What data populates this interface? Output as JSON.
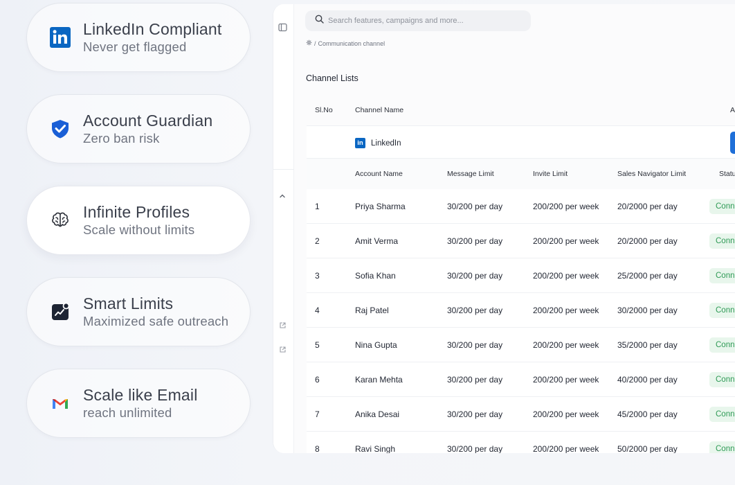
{
  "features": [
    {
      "title": "LinkedIn Compliant",
      "subtitle": "Never get flagged",
      "icon": "linkedin-icon"
    },
    {
      "title": "Account Guardian",
      "subtitle": "Zero ban risk",
      "icon": "shield-check-icon"
    },
    {
      "title": "Infinite Profiles",
      "subtitle": "Scale without limits",
      "icon": "brain-icon"
    },
    {
      "title": "Smart Limits",
      "subtitle": "Maximized safe outreach",
      "icon": "chart-trend-icon"
    },
    {
      "title": "Scale like Email",
      "subtitle": "reach unlimited",
      "icon": "gmail-icon"
    }
  ],
  "search": {
    "placeholder": "Search features, campaigns and more..."
  },
  "breadcrumb": {
    "separator": "/",
    "current": "Communication channel"
  },
  "page": {
    "title": "Channel Lists"
  },
  "table": {
    "headers": {
      "sl": "Sl.No",
      "channel": "Channel Name",
      "action": "A"
    },
    "channel": {
      "name": "LinkedIn",
      "logo_text": "in"
    },
    "columns": {
      "account": "Account Name",
      "message": "Message Limit",
      "invite": "Invite Limit",
      "sales": "Sales Navigator Limit",
      "status": "Statu"
    },
    "rows": [
      {
        "sl": "1",
        "name": "Priya Sharma",
        "message": "30/200 per day",
        "invite": "200/200 per week",
        "sales": "20/2000 per day",
        "status": "Conn"
      },
      {
        "sl": "2",
        "name": "Amit Verma",
        "message": "30/200 per day",
        "invite": "200/200 per week",
        "sales": "20/2000 per day",
        "status": "Conn"
      },
      {
        "sl": "3",
        "name": "Sofia Khan",
        "message": "30/200 per day",
        "invite": "200/200 per week",
        "sales": "25/2000 per day",
        "status": "Conn"
      },
      {
        "sl": "4",
        "name": "Raj Patel",
        "message": "30/200 per day",
        "invite": "200/200 per week",
        "sales": "30/2000 per day",
        "status": "Conn"
      },
      {
        "sl": "5",
        "name": "Nina Gupta",
        "message": "30/200 per day",
        "invite": "200/200 per week",
        "sales": "35/2000 per day",
        "status": "Conn"
      },
      {
        "sl": "6",
        "name": "Karan Mehta",
        "message": "30/200 per day",
        "invite": "200/200 per week",
        "sales": "40/2000 per day",
        "status": "Conn"
      },
      {
        "sl": "7",
        "name": "Anika Desai",
        "message": "30/200 per day",
        "invite": "200/200 per week",
        "sales": "45/2000 per day",
        "status": "Conn"
      },
      {
        "sl": "8",
        "name": "Ravi Singh",
        "message": "30/200 per day",
        "invite": "200/200 per week",
        "sales": "50/2000 per day",
        "status": "Conn"
      }
    ]
  },
  "colors": {
    "linkedin": "#0a66c2",
    "accent_blue": "#1f6fd8",
    "status_bg": "#e8f6ec",
    "status_text": "#2e9a55"
  }
}
